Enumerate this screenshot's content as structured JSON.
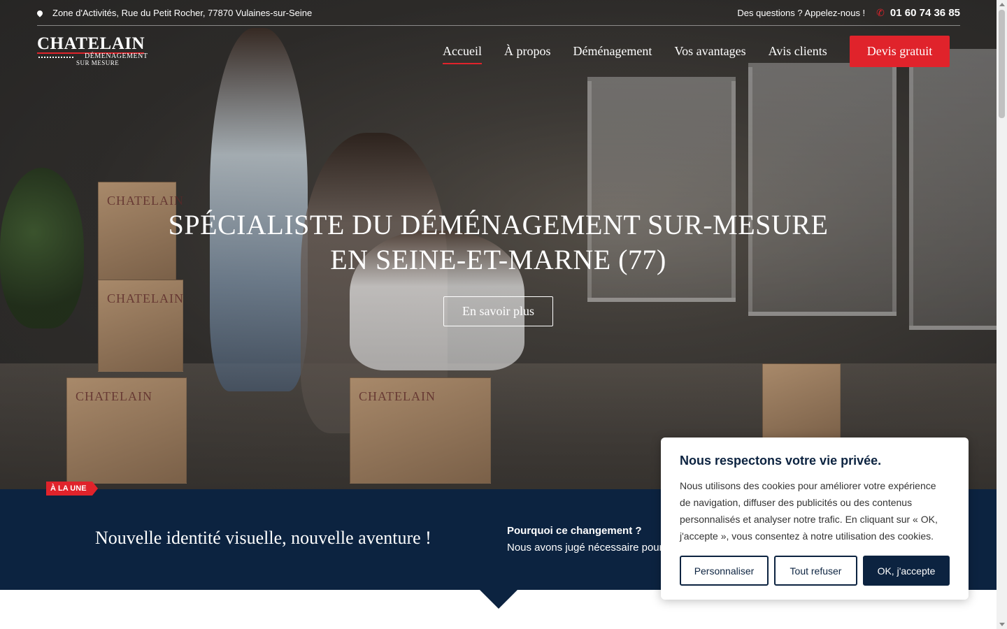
{
  "topbar": {
    "address": "Zone d'Activités, Rue du Petit Rocher, 77870 Vulaines-sur-Seine",
    "question": "Des questions ? Appelez-nous !",
    "phone": "01 60 74 36 85"
  },
  "logo": {
    "name": "CHATELAIN",
    "line1": "DÉMENAGEMENT",
    "line2": "SUR MESURE"
  },
  "nav": {
    "items": [
      "Accueil",
      "À propos",
      "Déménagement",
      "Vos avantages",
      "Avis clients"
    ],
    "active": "Accueil",
    "cta": "Devis gratuit"
  },
  "hero": {
    "title_line1": "SPÉCIALISTE DU DÉMÉNAGEMENT SUR-MESURE",
    "title_line2": "EN SEINE-ET-MARNE (77)",
    "button": "En savoir plus"
  },
  "news": {
    "badge": "À LA UNE",
    "title": "Nouvelle identité visuelle, nouvelle aventure !",
    "text_bold": "Pourquoi ce changement ?",
    "text_rest": " Nous avons jugé nécessaire pour être en phase avec"
  },
  "cookie": {
    "title": "Nous respectons votre vie privée.",
    "body": "Nous utilisons des cookies pour améliorer votre expérience de navigation, diffuser des publicités ou des contenus personnalisés et analyser notre trafic. En cliquant sur « OK, j'accepte », vous consentez à notre utilisation des cookies.",
    "customize": "Personnaliser",
    "refuse": "Tout refuser",
    "accept": "OK, j'accepte"
  },
  "colors": {
    "accent": "#e0232b",
    "navy": "#0c2340"
  }
}
